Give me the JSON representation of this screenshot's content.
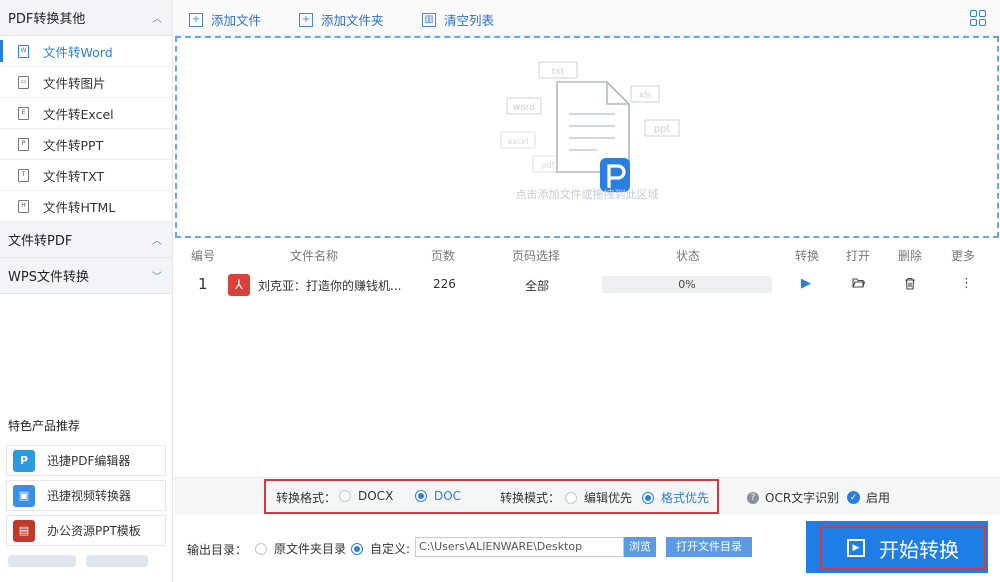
{
  "sidebar": {
    "sections": [
      {
        "title": "PDF转换其他",
        "chevron": "chevron-up"
      },
      {
        "title": "文件转PDF",
        "chevron": "chevron-up"
      },
      {
        "title": "WPS文件转换",
        "chevron": "chevron-down"
      }
    ],
    "items": [
      {
        "label": "文件转Word",
        "icon": "W",
        "active": true
      },
      {
        "label": "文件转图片",
        "icon": "▭"
      },
      {
        "label": "文件转Excel",
        "icon": "E"
      },
      {
        "label": "文件转PPT",
        "icon": "P"
      },
      {
        "label": "文件转TXT",
        "icon": "T"
      },
      {
        "label": "文件转HTML",
        "icon": "H"
      }
    ],
    "recommend_title": "特色产品推荐",
    "recommend": [
      {
        "label": "迅捷PDF编辑器",
        "color": "#2d9ae0"
      },
      {
        "label": "迅捷视频转换器",
        "color": "#3a8ee6"
      },
      {
        "label": "办公资源PPT模板",
        "color": "#c0392b"
      }
    ]
  },
  "toolbar": {
    "add_file": "添加文件",
    "add_folder": "添加文件夹",
    "clear_list": "清空列表"
  },
  "dropzone": {
    "hint": "点击添加文件或拖拽到此区域",
    "tags": [
      "txt",
      "word",
      "xls",
      "ppt",
      "excel",
      "pdf"
    ]
  },
  "table": {
    "headers": {
      "num": "编号",
      "name": "文件名称",
      "pages": "页数",
      "page_select": "页码选择",
      "status": "状态",
      "convert": "转换",
      "open": "打开",
      "delete": "删除",
      "more": "更多"
    },
    "rows": [
      {
        "num": "1",
        "name": "刘克亚：打造你的赚钱机...",
        "pages": "226",
        "page_select": "全部",
        "status": "0%",
        "progress": 0
      }
    ]
  },
  "options": {
    "format_label": "转换格式：",
    "format_options": [
      "DOCX",
      "DOC"
    ],
    "format_selected": "DOC",
    "mode_label": "转换模式：",
    "mode_options": [
      "编辑优先",
      "格式优先"
    ],
    "mode_selected": "格式优先",
    "ocr_label": "OCR文字识别",
    "ocr_enable": "启用"
  },
  "output": {
    "label": "输出目录：",
    "opt_original": "原文件夹目录",
    "opt_custom": "自定义:",
    "path": "C:\\Users\\ALIENWARE\\Desktop",
    "browse": "浏览",
    "open_dir": "打开文件目录",
    "start": "开始转换"
  },
  "colors": {
    "accent": "#2a7ee0",
    "highlight": "#d9383a",
    "pdf_icon": "#d9423c"
  }
}
